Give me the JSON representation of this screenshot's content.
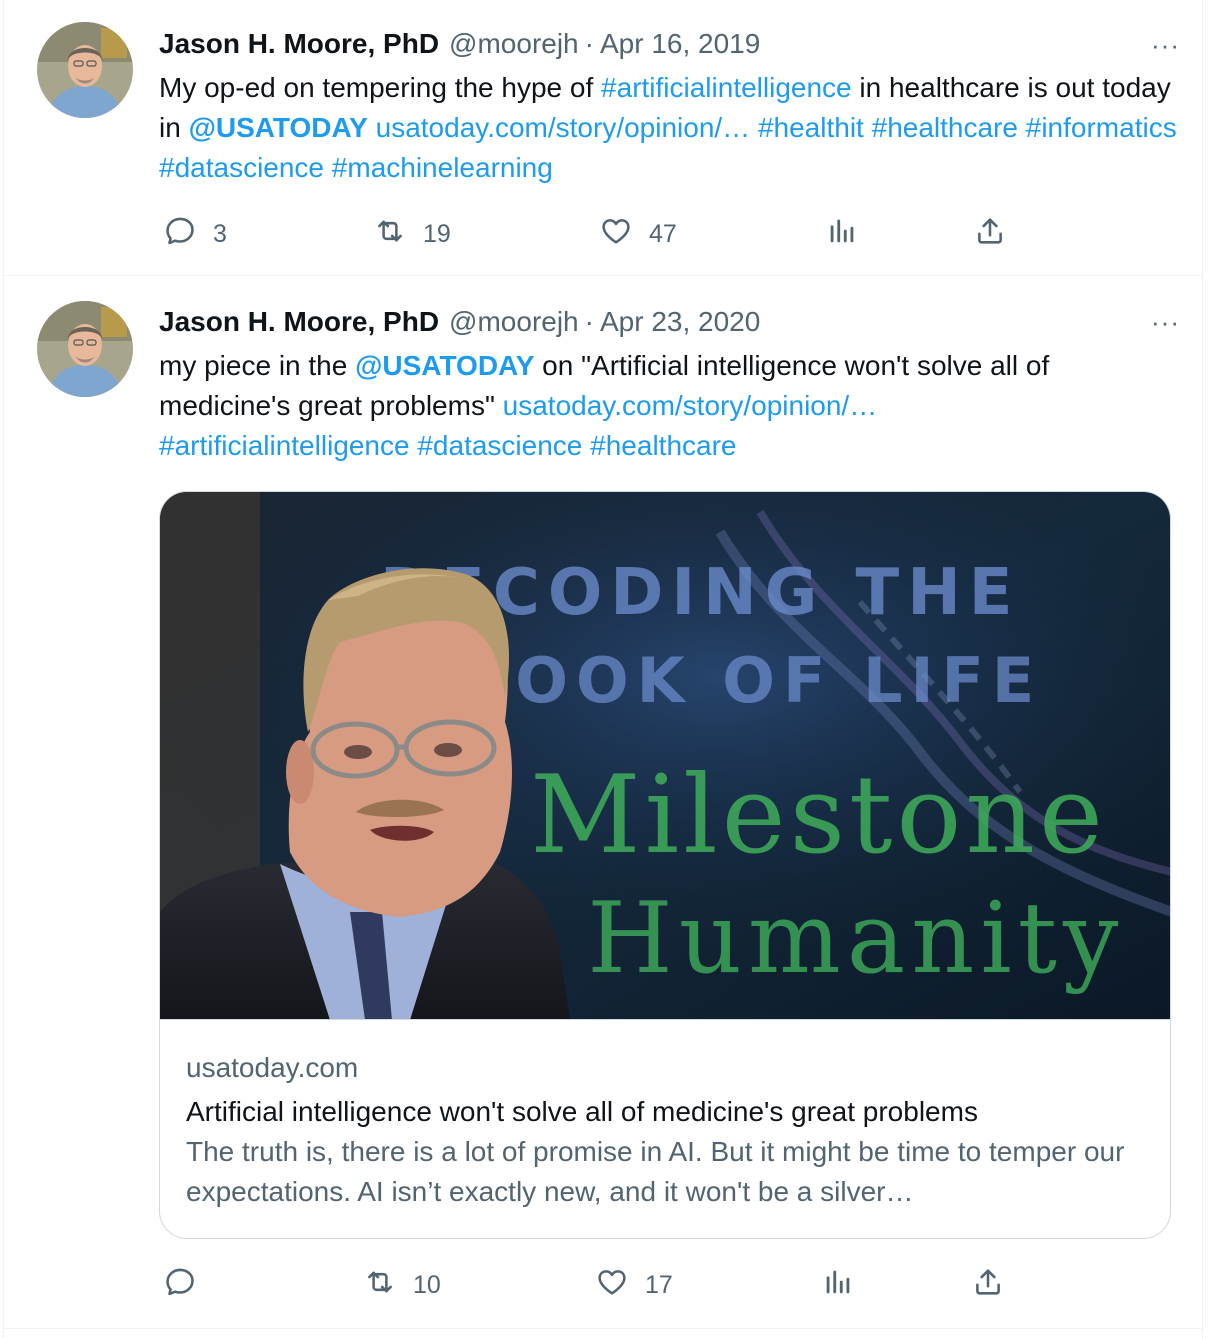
{
  "tweets": [
    {
      "author": {
        "name": "Jason H. Moore, PhD",
        "handle": "@moorejh"
      },
      "separator": "·",
      "date": "Apr 16, 2019",
      "more": "···",
      "text": {
        "t1": "My op-ed on tempering the hype of ",
        "l1": "#artificialintelligence",
        "t2": " in healthcare is out today in ",
        "m1": "@USATODAY",
        "t3": " ",
        "l2": "usatoday.com/story/opinion/…",
        "t4": " ",
        "l3": "#healthit",
        "t5": " ",
        "l4": "#healthcare",
        "t6": " ",
        "l5": "#informatics",
        "t7": " ",
        "l6": "#datascience",
        "t8": " ",
        "l7": "#machinelearning"
      },
      "actions": {
        "replies": "3",
        "retweets": "19",
        "likes": "47"
      }
    },
    {
      "author": {
        "name": "Jason H. Moore, PhD",
        "handle": "@moorejh"
      },
      "separator": "·",
      "date": "Apr 23, 2020",
      "more": "···",
      "text": {
        "t1": "my piece in the ",
        "m1": "@USATODAY",
        "t2": " on \"Artificial intelligence won't solve all of medicine's great problems\" ",
        "l1": "usatoday.com/story/opinion/…",
        "t3": " ",
        "l2": "#artificialintelligence",
        "t4": " ",
        "l3": "#datascience",
        "t5": " ",
        "l4": "#healthcare"
      },
      "card": {
        "image_text": {
          "line1": "DECODING THE",
          "line2": "BOOK OF LIFE",
          "line3": "Milestone",
          "line4": "for Humanity"
        },
        "domain": "usatoday.com",
        "title": "Artificial intelligence won't solve all of medicine's great problems",
        "description": "The truth is, there is a lot of promise in AI. But it might be time to temper our expectations. AI isn’t exactly new, and it won't be a silver…"
      },
      "actions": {
        "replies": "",
        "retweets": "10",
        "likes": "17"
      }
    }
  ],
  "icons": {
    "reply": "reply-icon",
    "retweet": "retweet-icon",
    "like": "heart-icon",
    "views": "analytics-icon",
    "share": "share-icon",
    "more": "more-icon"
  },
  "colors": {
    "link": "#1d9bf0",
    "text": "#0f1419",
    "secondary": "#536471",
    "border": "#cfd9de"
  }
}
